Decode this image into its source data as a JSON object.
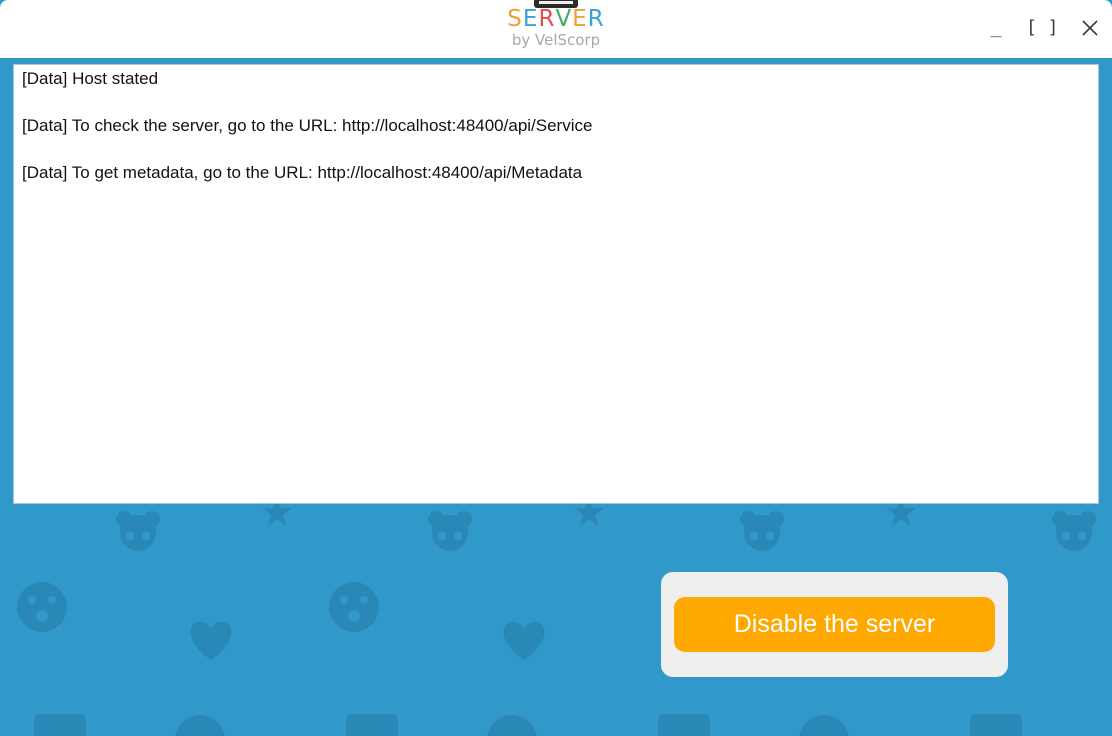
{
  "titlebar": {
    "brand_title_letters": [
      {
        "char": "S",
        "color": "#f0a030"
      },
      {
        "char": "E",
        "color": "#3aa0d8"
      },
      {
        "char": "R",
        "color": "#e05050"
      },
      {
        "char": "V",
        "color": "#40b060"
      },
      {
        "char": "E",
        "color": "#f0a030"
      },
      {
        "char": "R",
        "color": "#3aa0d8"
      }
    ],
    "brand_subtitle": "by VelScorp",
    "minimize_label": "_",
    "maximize_label": "[ ]",
    "close_icon": "close-icon"
  },
  "log": {
    "lines": [
      "[Data] Host stated",
      "[Data] To check the server, go to the URL: http://localhost:48400/api/Service",
      "[Data] To get metadata, go to the URL: http://localhost:48400/api/Metadata"
    ]
  },
  "action": {
    "disable_button_label": "Disable the server"
  },
  "colors": {
    "background": "#3199c9",
    "pattern": "#2a88b6",
    "button": "#ffa800",
    "panel": "#efefef"
  }
}
